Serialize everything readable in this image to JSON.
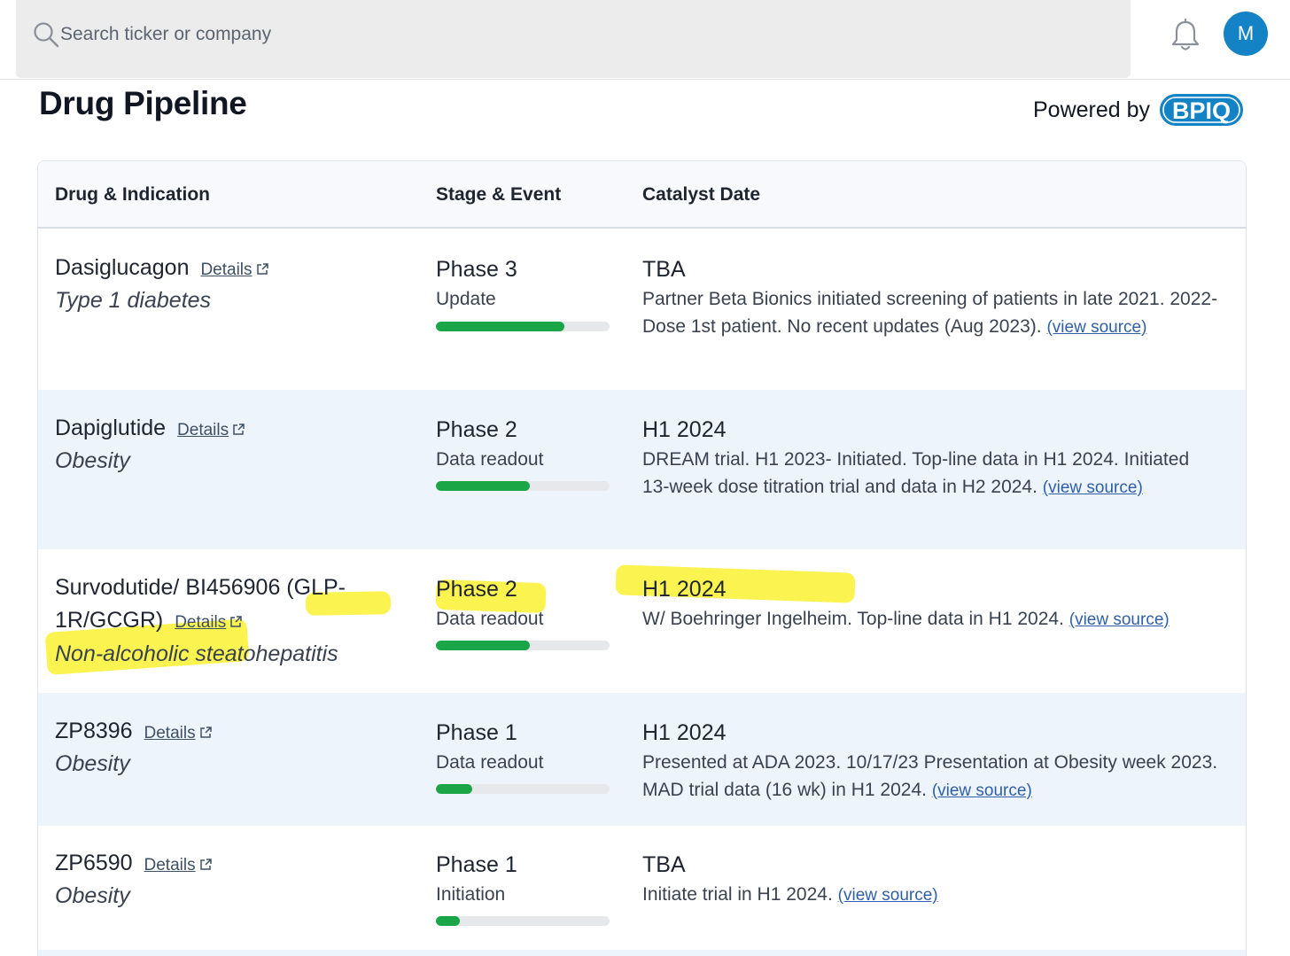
{
  "search": {
    "placeholder": "Search ticker or company"
  },
  "user": {
    "avatar_initial": "M"
  },
  "page": {
    "title": "Drug Pipeline",
    "powered_by": "Powered by",
    "logo_text": "BPIQ"
  },
  "table": {
    "headers": [
      "Drug & Indication",
      "Stage & Event",
      "Catalyst Date"
    ],
    "rows": [
      {
        "drug": "Dasiglucagon",
        "details": "Details",
        "indication": "Type 1 diabetes",
        "stage": "Phase 3",
        "event": "Update",
        "progress": 0.74,
        "date": "TBA",
        "desc": "Partner Beta Bionics initiated screening of patients in late 2021. 2022- Dose 1st patient. No recent updates (Aug 2023).",
        "source": "(view source)"
      },
      {
        "drug": "Dapiglutide",
        "details": "Details",
        "indication": "Obesity",
        "stage": "Phase 2",
        "event": "Data readout",
        "progress": 0.54,
        "date": "H1 2024",
        "desc": "DREAM trial. H1 2023- Initiated. Top-line data in H1 2024. Initiated 13-week dose titration trial and data in H2 2024.",
        "source": "(view source)"
      },
      {
        "drug": "Survodutide/ BI456906 (GLP-1R/GCGR)",
        "details": "Details",
        "indication": "Non-alcoholic steatohepatitis",
        "stage": "Phase 2",
        "event": "Data readout",
        "progress": 0.54,
        "date": "H1 2024",
        "desc": "W/ Boehringer Ingelheim. Top-line data in H1 2024.",
        "source": "(view source)"
      },
      {
        "drug": "ZP8396",
        "details": "Details",
        "indication": "Obesity",
        "stage": "Phase 1",
        "event": "Data readout",
        "progress": 0.21,
        "date": "H1 2024",
        "desc": "Presented at ADA 2023. 10/17/23 Presentation at Obesity week 2023. MAD trial data (16 wk) in H1 2024.",
        "source": "(view source)"
      },
      {
        "drug": "ZP6590",
        "details": "Details",
        "indication": "Obesity",
        "stage": "Phase 1",
        "event": "Initiation",
        "progress": 0.14,
        "date": "TBA",
        "desc": "Initiate trial in H1 2024.",
        "source": "(view source)"
      }
    ]
  },
  "colors": {
    "accent": "#1483c6",
    "progress": "#1aa547",
    "highlight": "#faf028",
    "row_alt": "#eef4fc"
  }
}
